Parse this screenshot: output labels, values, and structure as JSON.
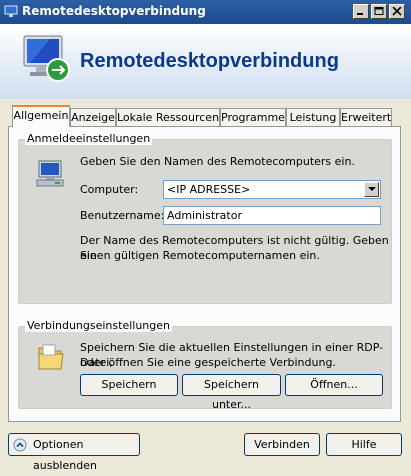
{
  "window": {
    "title": "Remotedesktopverbindung"
  },
  "banner": {
    "heading": "Remotedesktopverbindung"
  },
  "tabs": [
    {
      "label": "Allgemein"
    },
    {
      "label": "Anzeige"
    },
    {
      "label": "Lokale Ressourcen"
    },
    {
      "label": "Programme"
    },
    {
      "label": "Leistung"
    },
    {
      "label": "Erweitert"
    }
  ],
  "login": {
    "title": "Anmeldeeinstellungen",
    "intro": "Geben Sie den Namen des Remotecomputers ein.",
    "computer_label": "Computer:",
    "computer_value": "<IP ADRESSE>",
    "user_label": "Benutzername:",
    "user_value": "Administrator",
    "error_line1": "Der Name des Remotecomputers ist nicht gültig. Geben Sie",
    "error_line2": "einen gültigen Remotecomputernamen ein."
  },
  "connection": {
    "title": "Verbindungseinstellungen",
    "desc_line1": "Speichern Sie die aktuellen Einstellungen in einer RDP-Datei,",
    "desc_line2": "oder öffnen Sie eine gespeicherte Verbindung.",
    "save": "Speichern",
    "save_as": "Speichern unter...",
    "open": "Öffnen..."
  },
  "footer": {
    "options": "Optionen ausblenden",
    "connect": "Verbinden",
    "help": "Hilfe"
  },
  "icons": [
    "app-icon",
    "minimize-icon",
    "maximize-icon",
    "close-icon",
    "remote-desktop-logo-icon",
    "computer-icon",
    "folder-icon",
    "chevron-up-icon",
    "dropdown-arrow-icon"
  ]
}
